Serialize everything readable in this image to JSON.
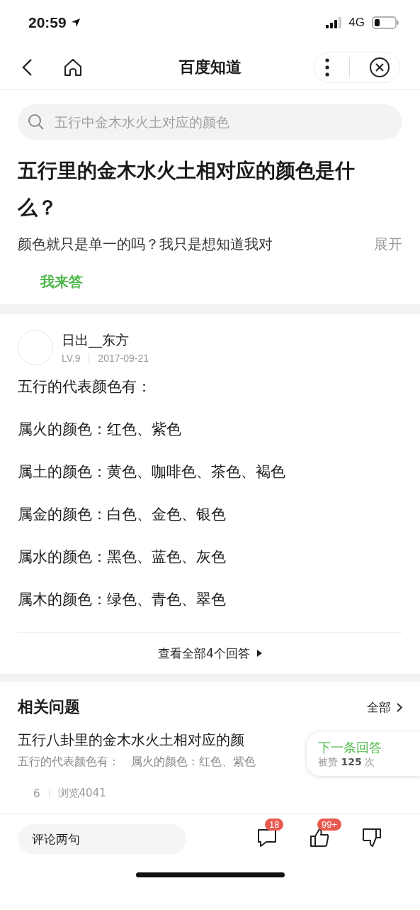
{
  "status_bar": {
    "time": "20:59",
    "network": "4G"
  },
  "nav": {
    "title": "百度知道"
  },
  "search": {
    "placeholder": "五行中金木水火土对应的颜色"
  },
  "question": {
    "title": "五行里的金木水火土相对应的颜色是什么？",
    "description": "颜色就只是单一的吗？我只是想知道我对",
    "expand": "展开",
    "answer_button": "我来答"
  },
  "answer": {
    "author": "日出__东方",
    "level": "LV.9",
    "date": "2017-09-21",
    "paragraphs": [
      "五行的代表颜色有：",
      "属火的颜色：红色、紫色",
      "属土的颜色：黄色、咖啡色、茶色、褐色",
      "属金的颜色：白色、金色、银色",
      "属水的颜色：黑色、蓝色、灰色",
      "属木的颜色：绿色、青色、翠色"
    ],
    "view_all": "查看全部4个回答"
  },
  "related": {
    "heading": "相关问题",
    "all": "全部",
    "items": [
      {
        "title": "五行八卦里的金木水火土相对应的颜",
        "summary": "五行的代表颜色有：　属火的颜色：红色、紫色",
        "likes": "6",
        "views": "浏览4041"
      }
    ]
  },
  "next_card": {
    "label": "下一条回答",
    "praise": "被赞 **125** 次"
  },
  "bottom_bar": {
    "comment_placeholder": "评论两句",
    "comment_count": "18",
    "like_count": "99+"
  }
}
